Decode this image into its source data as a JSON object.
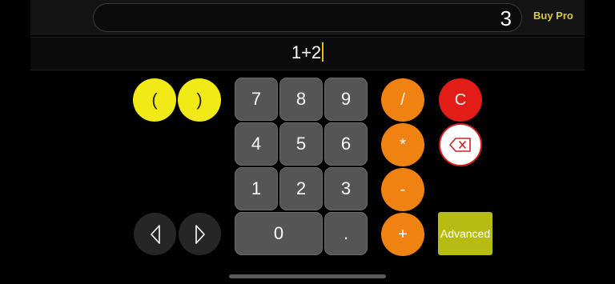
{
  "header": {
    "result": "3",
    "buy_pro_label": "Buy Pro"
  },
  "expression": {
    "text": "1+2"
  },
  "keys": {
    "paren_open": "(",
    "paren_close": ")",
    "n7": "7",
    "n8": "8",
    "n9": "9",
    "n4": "4",
    "n5": "5",
    "n6": "6",
    "n1": "1",
    "n2": "2",
    "n3": "3",
    "n0": "0",
    "dot": ".",
    "divide": "/",
    "multiply": "*",
    "minus": "-",
    "plus": "+",
    "clear": "C",
    "advanced": "Advanced"
  },
  "icons": {
    "backspace": "backspace-icon",
    "cursor_left": "triangle-left-icon",
    "cursor_right": "triangle-right-icon"
  },
  "colors": {
    "yellow": "#f2ea16",
    "orange": "#f08212",
    "red": "#e21c16",
    "digit_grey": "#555555",
    "advanced_green": "#b7bc12",
    "buy_pro": "#d9c93a",
    "caret": "#e8c000"
  }
}
